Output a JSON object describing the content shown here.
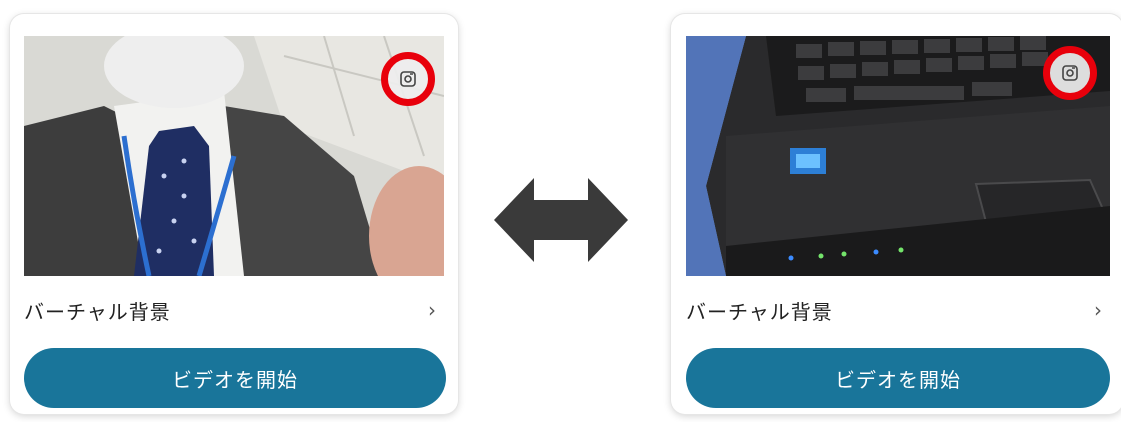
{
  "cards": [
    {
      "virtual_background_label": "バーチャル背景",
      "chevron": "›",
      "start_video_label": "ビデオを開始",
      "camera_switch_icon": "camera-switch-icon",
      "highlight_color": "#e8000b"
    },
    {
      "virtual_background_label": "バーチャル背景",
      "chevron": "›",
      "start_video_label": "ビデオを開始",
      "camera_switch_icon": "camera-switch-icon",
      "highlight_color": "#e8000b"
    }
  ],
  "swap_icon": "double-arrow-icon",
  "colors": {
    "button": "#19759a",
    "arrow": "#3a3a3a",
    "highlight": "#e8000b"
  }
}
